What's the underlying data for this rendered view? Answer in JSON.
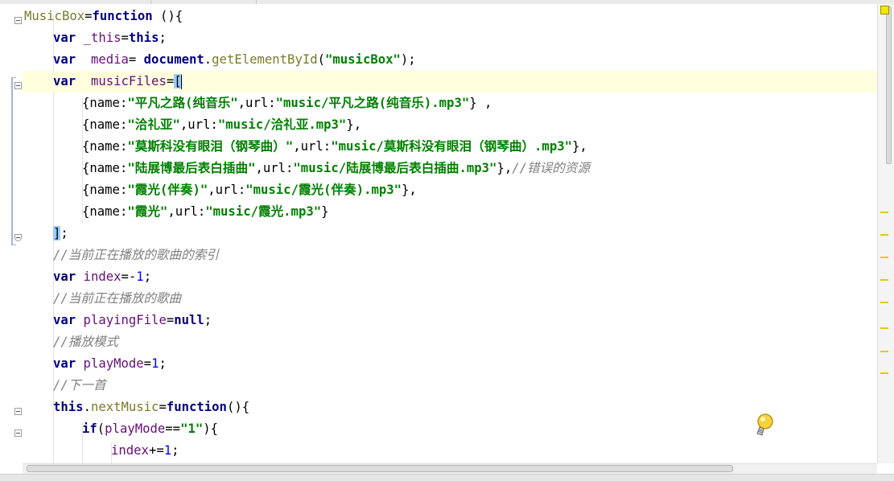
{
  "editor": {
    "lines": [
      {
        "tokens": [
          {
            "t": "MusicBox",
            "c": "fn"
          },
          {
            "t": "=",
            "c": "punc"
          },
          {
            "t": "function",
            "c": "kw"
          },
          {
            "t": " (){",
            "c": "punc"
          }
        ]
      },
      {
        "indent": 1,
        "tokens": [
          {
            "t": "var",
            "c": "kw"
          },
          {
            "t": " _this",
            "c": "prop"
          },
          {
            "t": "=",
            "c": "punc"
          },
          {
            "t": "this",
            "c": "kw"
          },
          {
            "t": ";",
            "c": "punc"
          }
        ]
      },
      {
        "indent": 1,
        "tokens": [
          {
            "t": "var",
            "c": "kw"
          },
          {
            "t": "  media",
            "c": "prop"
          },
          {
            "t": "= ",
            "c": "punc"
          },
          {
            "t": "document",
            "c": "kw"
          },
          {
            "t": ".",
            "c": "punc"
          },
          {
            "t": "getElementById",
            "c": "fn"
          },
          {
            "t": "(",
            "c": "punc"
          },
          {
            "t": "\"musicBox\"",
            "c": "str"
          },
          {
            "t": ");",
            "c": "punc"
          }
        ]
      },
      {
        "indent": 1,
        "current": true,
        "tokens": [
          {
            "t": "var",
            "c": "kw"
          },
          {
            "t": "  musicFiles",
            "c": "prop"
          },
          {
            "t": "=",
            "c": "punc"
          },
          {
            "t": "[",
            "c": "punc brace-hl"
          },
          {
            "t": "",
            "c": "caret"
          }
        ]
      },
      {
        "indent": 2,
        "tokens": [
          {
            "t": "{name:",
            "c": "punc"
          },
          {
            "t": "\"平凡之路(纯音乐\"",
            "c": "str"
          },
          {
            "t": ",url:",
            "c": "punc"
          },
          {
            "t": "\"music/平凡之路(纯音乐).mp3\"",
            "c": "str"
          },
          {
            "t": "} ,",
            "c": "punc"
          }
        ]
      },
      {
        "indent": 2,
        "tokens": [
          {
            "t": "{name:",
            "c": "punc"
          },
          {
            "t": "\"洽礼亚\"",
            "c": "str"
          },
          {
            "t": ",url:",
            "c": "punc"
          },
          {
            "t": "\"music/洽礼亚.mp3\"",
            "c": "str"
          },
          {
            "t": "},",
            "c": "punc"
          }
        ]
      },
      {
        "indent": 2,
        "tokens": [
          {
            "t": "{name:",
            "c": "punc"
          },
          {
            "t": "\"莫斯科没有眼泪（钢琴曲）\"",
            "c": "str"
          },
          {
            "t": ",url:",
            "c": "punc"
          },
          {
            "t": "\"music/莫斯科没有眼泪（钢琴曲）.mp3\"",
            "c": "str"
          },
          {
            "t": "},",
            "c": "punc"
          }
        ]
      },
      {
        "indent": 2,
        "tokens": [
          {
            "t": "{name:",
            "c": "punc"
          },
          {
            "t": "\"陆展博最后表白插曲\"",
            "c": "str"
          },
          {
            "t": ",url:",
            "c": "punc"
          },
          {
            "t": "\"music/陆展博最后表白插曲.mp3\"",
            "c": "str"
          },
          {
            "t": "},",
            "c": "punc"
          },
          {
            "t": "//错误的资源",
            "c": "cm"
          }
        ]
      },
      {
        "indent": 2,
        "tokens": [
          {
            "t": "{name:",
            "c": "punc"
          },
          {
            "t": "\"霞光(伴奏)\"",
            "c": "str"
          },
          {
            "t": ",url:",
            "c": "punc"
          },
          {
            "t": "\"music/霞光(伴奏).mp3\"",
            "c": "str"
          },
          {
            "t": "},",
            "c": "punc"
          }
        ]
      },
      {
        "indent": 2,
        "tokens": [
          {
            "t": "{name:",
            "c": "punc"
          },
          {
            "t": "\"霞光\"",
            "c": "str"
          },
          {
            "t": ",url:",
            "c": "punc"
          },
          {
            "t": "\"music/霞光.mp3\"",
            "c": "str"
          },
          {
            "t": "}",
            "c": "punc"
          }
        ]
      },
      {
        "indent": 1,
        "tokens": [
          {
            "t": "]",
            "c": "punc brace-hl"
          },
          {
            "t": ";",
            "c": "punc"
          }
        ]
      },
      {
        "indent": 1,
        "tokens": [
          {
            "t": "//当前正在播放的歌曲的索引",
            "c": "cm"
          }
        ]
      },
      {
        "indent": 1,
        "tokens": [
          {
            "t": "var",
            "c": "kw"
          },
          {
            "t": " index",
            "c": "prop"
          },
          {
            "t": "=-",
            "c": "punc"
          },
          {
            "t": "1",
            "c": "num"
          },
          {
            "t": ";",
            "c": "punc"
          }
        ]
      },
      {
        "indent": 1,
        "tokens": [
          {
            "t": "//当前正在播放的歌曲",
            "c": "cm"
          }
        ]
      },
      {
        "indent": 1,
        "tokens": [
          {
            "t": "var",
            "c": "kw"
          },
          {
            "t": " playingFile",
            "c": "prop"
          },
          {
            "t": "=",
            "c": "punc"
          },
          {
            "t": "null",
            "c": "kw"
          },
          {
            "t": ";",
            "c": "punc"
          }
        ]
      },
      {
        "indent": 1,
        "tokens": [
          {
            "t": "//播放模式",
            "c": "cm"
          }
        ]
      },
      {
        "indent": 1,
        "tokens": [
          {
            "t": "var",
            "c": "kw"
          },
          {
            "t": " playMode",
            "c": "prop"
          },
          {
            "t": "=",
            "c": "punc"
          },
          {
            "t": "1",
            "c": "num"
          },
          {
            "t": ";",
            "c": "punc"
          }
        ]
      },
      {
        "indent": 1,
        "tokens": [
          {
            "t": "//下一首",
            "c": "cm"
          }
        ]
      },
      {
        "indent": 1,
        "tokens": [
          {
            "t": "this",
            "c": "kw"
          },
          {
            "t": ".",
            "c": "punc"
          },
          {
            "t": "nextMusic",
            "c": "fn"
          },
          {
            "t": "=",
            "c": "punc"
          },
          {
            "t": "function",
            "c": "kw"
          },
          {
            "t": "(){",
            "c": "punc"
          }
        ]
      },
      {
        "indent": 2,
        "tokens": [
          {
            "t": "if",
            "c": "kw"
          },
          {
            "t": "(",
            "c": "punc"
          },
          {
            "t": "playMode",
            "c": "prop"
          },
          {
            "t": "==",
            "c": "punc"
          },
          {
            "t": "\"1\"",
            "c": "str"
          },
          {
            "t": "){",
            "c": "punc"
          }
        ]
      },
      {
        "indent": 3,
        "tokens": [
          {
            "t": "index",
            "c": "prop"
          },
          {
            "t": "+=",
            "c": "punc"
          },
          {
            "t": "1",
            "c": "num"
          },
          {
            "t": ";",
            "c": "punc"
          }
        ]
      }
    ]
  },
  "icons": {
    "intention": "lightbulb-icon",
    "error_stripe": "error-stripe-marker-icon",
    "fold": "fold-marker-icon"
  },
  "colors": {
    "keyword": "#000080",
    "string": "#008000",
    "comment": "#808080",
    "number": "#0000ff",
    "current_line": "#ffffdd",
    "brace_highlight": "#99ccff"
  }
}
